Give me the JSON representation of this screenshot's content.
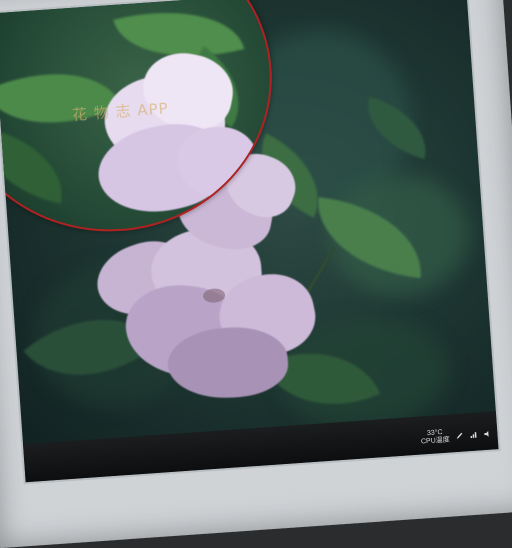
{
  "magnifier": {
    "caption": "花 物 志 APP",
    "border_color": "#b02222"
  },
  "taskbar": {
    "temperature": "33°C",
    "weather": "CPU温度"
  },
  "icons": [
    "pen-icon",
    "network-icon",
    "volume-icon"
  ],
  "colors": {
    "bezel": "#cfd3d6",
    "screen_dark": "#162a28",
    "petal": "#d9c6e6",
    "leaf": "#3f7447"
  }
}
